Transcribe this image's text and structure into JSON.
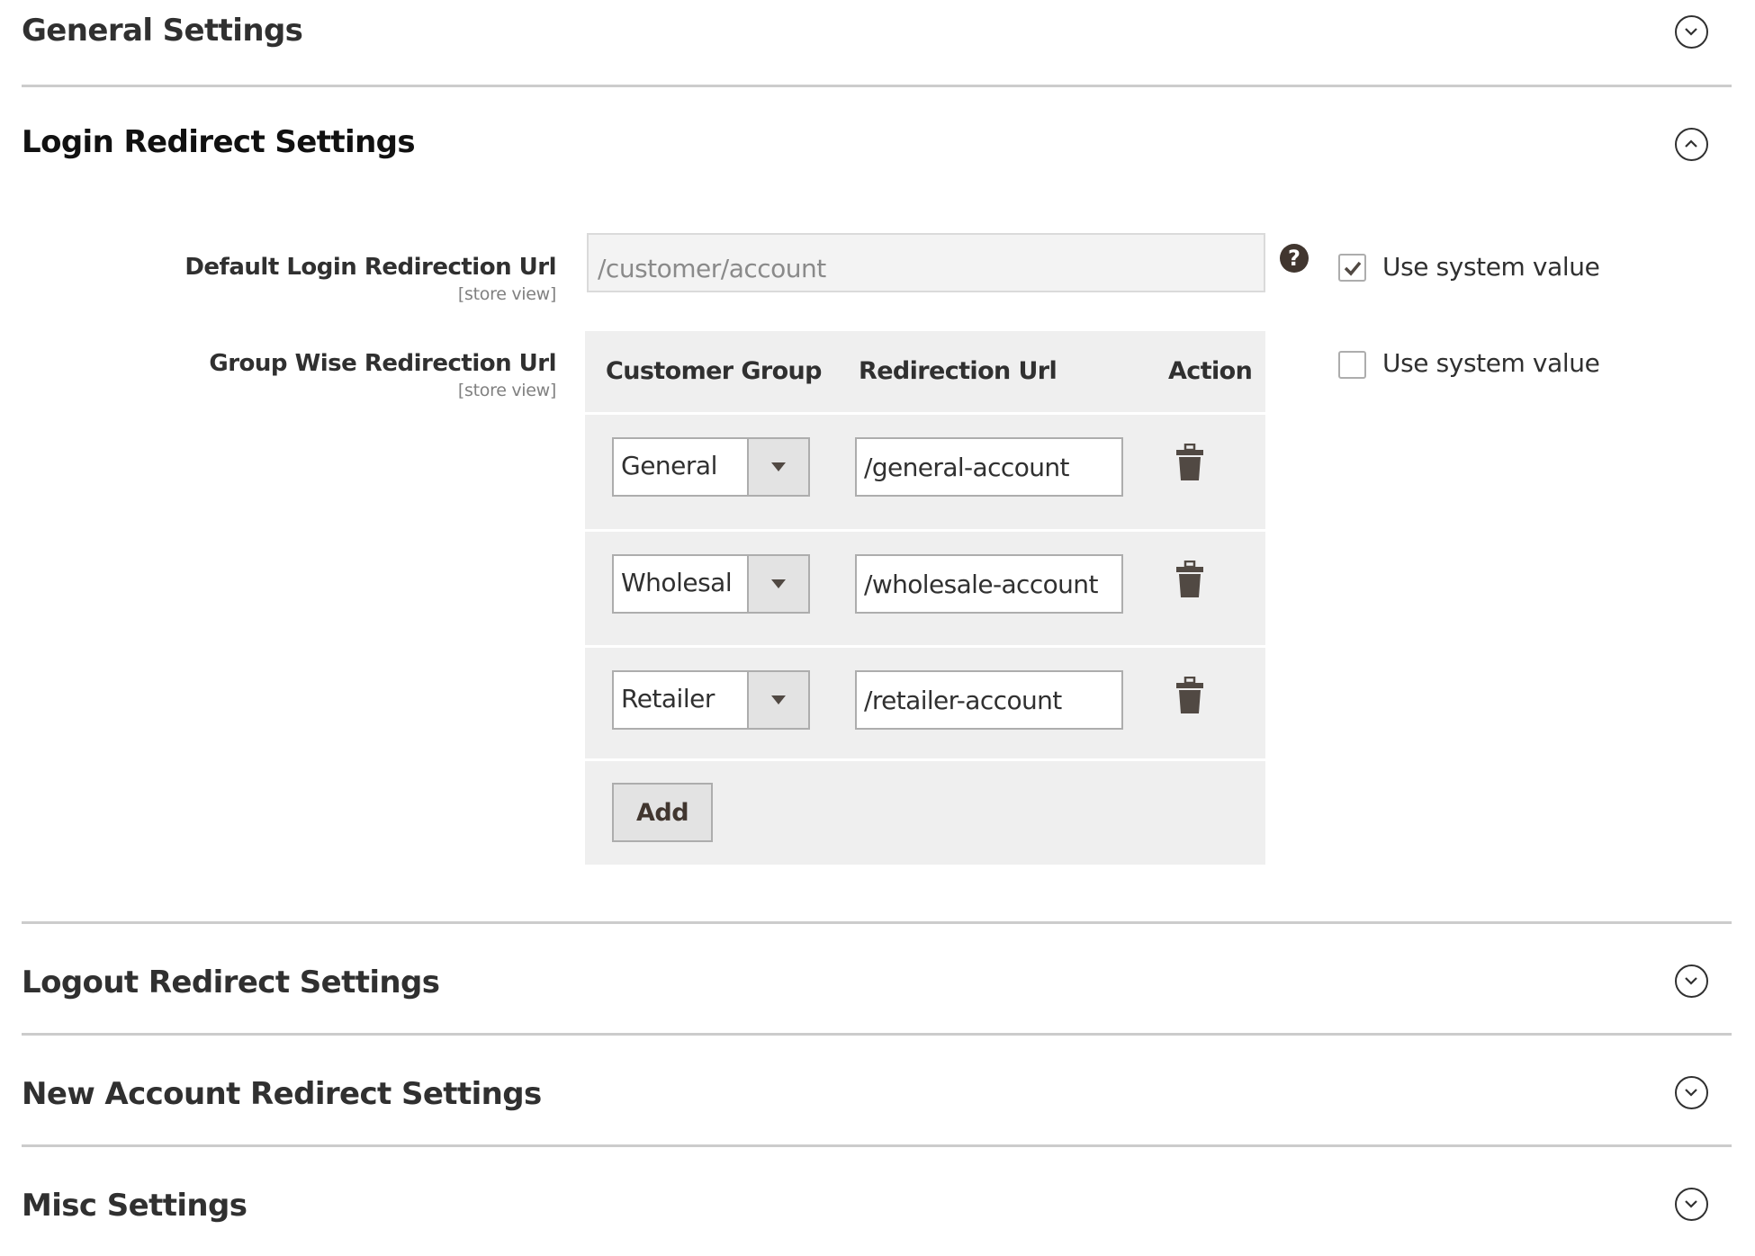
{
  "sections": {
    "general": {
      "title": "General Settings",
      "state": "collapsed"
    },
    "login": {
      "title": "Login Redirect Settings",
      "state": "expanded"
    },
    "logout": {
      "title": "Logout Redirect Settings",
      "state": "collapsed"
    },
    "new_account": {
      "title": "New Account Redirect Settings",
      "state": "collapsed"
    },
    "misc": {
      "title": "Misc Settings",
      "state": "collapsed"
    }
  },
  "login": {
    "default_url": {
      "label": "Default Login Redirection Url",
      "scope": "[store view]",
      "value": "/customer/account",
      "help_icon": "question-circle-icon",
      "use_system_value": {
        "label": "Use system value",
        "checked": true
      }
    },
    "group_wise": {
      "label": "Group Wise Redirection Url",
      "scope": "[store view]",
      "use_system_value": {
        "label": "Use system value",
        "checked": false
      },
      "columns": [
        "Customer Group",
        "Redirection Url",
        "Action"
      ],
      "rows": [
        {
          "group": "General",
          "url": "/general-account"
        },
        {
          "group": "Wholesal",
          "url": "/wholesale-account"
        },
        {
          "group": "Retailer",
          "url": "/retailer-account"
        }
      ],
      "add_label": "Add"
    }
  },
  "icons": {
    "collapsed": "chevron-down-circle-icon",
    "expanded": "chevron-up-circle-icon",
    "delete": "trash-icon",
    "dropdown": "caret-down-icon"
  },
  "colors": {
    "text": "#303030",
    "grid_bg": "#efefef",
    "divider": "#cccccc",
    "icon_dark": "#514943"
  }
}
